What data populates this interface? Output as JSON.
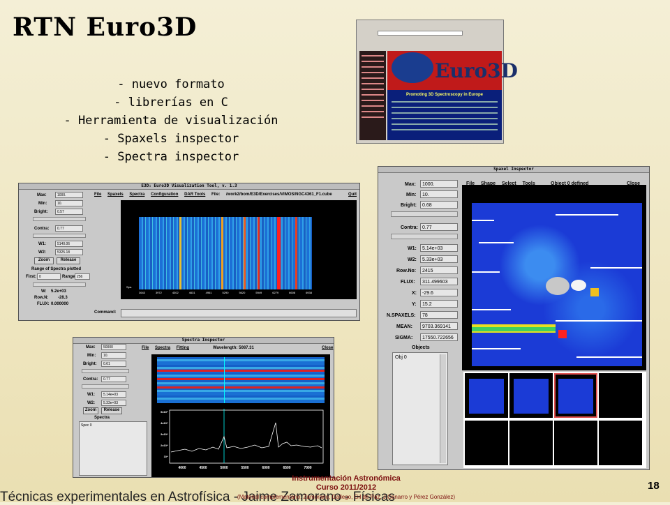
{
  "slide": {
    "title": "RTN Euro3D",
    "bullets": [
      "- nuevo formato",
      "- librerías en C",
      "- Herramienta de visualización",
      "- Spaxels inspector",
      "- Spectra inspector"
    ],
    "footer_left": "Técnicas experimentales en Astrofísica - Jaime Zamorano - Físicas",
    "footer_course": "Instrumentación Astronómica",
    "footer_year": "Curso 2011/2012",
    "footer_credit": "(Material complementario: Zamorano, Gallego, Gil de Paz, J.Cenarro y Pérez González)",
    "page_number": "18"
  },
  "website": {
    "logo_text": "Euro3D",
    "tagline": "Promoting 3D Spectroscopy in Europe"
  },
  "e3d_window": {
    "title": "E3D: Euro3D Visualization Tool, v. 1.3",
    "menu": [
      "File",
      "Spaxels",
      "Spectra",
      "Configuration",
      "DAR Tools",
      "File:"
    ],
    "file_path": "/work2/bom/E3D/Exercises/VIMOS/NGC4361_F1.cube",
    "quit": "Quit",
    "fields": [
      {
        "label": "Max:",
        "value": "1000."
      },
      {
        "label": "Min:",
        "value": "10."
      },
      {
        "label": "Bright:",
        "value": "0.57"
      },
      {
        "label": "Contra:",
        "value": "0.77"
      },
      {
        "label": "W1:",
        "value": "5140.06"
      },
      {
        "label": "W2:",
        "value": "5325.18"
      }
    ],
    "zoom": "Zoom",
    "release": "Release",
    "range_label": "Range of Spectra plotted",
    "first_label": "First:",
    "first_value": "0",
    "range_label2": "Range:",
    "range_value": "256",
    "w_label": "W:",
    "w_value": "5.2e+03",
    "rown_label": "Row.N:",
    "rown_value": "-28.3",
    "flux_label": "FLUX:",
    "flux_value": "0.000000",
    "command_label": "Command:",
    "x_ticks": [
      "3643",
      "3972",
      "4302",
      "4631",
      "4961",
      "5290",
      "5620",
      "5949",
      "6279",
      "6608",
      "6938"
    ],
    "spax_label": "Spa."
  },
  "spectra_window": {
    "title": "Spectra Inspector",
    "menu": [
      "File",
      "Spectra",
      "Fitting"
    ],
    "wavelength": "Wavelength: 5087.31",
    "close": "Close",
    "fields": [
      {
        "label": "Max:",
        "value": "50000"
      },
      {
        "label": "Min:",
        "value": "10."
      },
      {
        "label": "Bright:",
        "value": "0.61"
      },
      {
        "label": "Contra:",
        "value": "0.77"
      },
      {
        "label": "W1:",
        "value": "5.14e+03"
      },
      {
        "label": "W2:",
        "value": "5.33e+03"
      }
    ],
    "zoom": "Zoom",
    "release": "Release",
    "spectra_label": "Spectra",
    "spectra_item": "Spec 0",
    "y_ticks": [
      "5x10⁴",
      "4x10⁴",
      "3x10⁴",
      "2x10⁴",
      "10⁴"
    ],
    "x_ticks": [
      "4000",
      "4500",
      "5000",
      "5500",
      "6000",
      "6500",
      "7000"
    ]
  },
  "spaxel_window": {
    "title": "Spaxel Inspector",
    "menu": [
      "File",
      "Shape",
      "Select",
      "Tools"
    ],
    "status": "Object 0 defined",
    "close": "Close",
    "fields": [
      {
        "label": "Max:",
        "value": "1000."
      },
      {
        "label": "Min:",
        "value": "10."
      },
      {
        "label": "Bright:",
        "value": "0.68"
      },
      {
        "label": "Contra:",
        "value": "0.77"
      },
      {
        "label": "W1:",
        "value": "5.14e+03"
      },
      {
        "label": "W2:",
        "value": "5.33e+03"
      },
      {
        "label": "Row.No:",
        "value": "2415"
      },
      {
        "label": "FLUX:",
        "value": "311.499603"
      },
      {
        "label": "X:",
        "value": "-29.6"
      },
      {
        "label": "Y:",
        "value": "15.2"
      },
      {
        "label": "N.SPAXELS:",
        "value": "78"
      },
      {
        "label": "MEAN:",
        "value": "9703.369141"
      },
      {
        "label": "SIGMA:",
        "value": "17550.722656"
      }
    ],
    "objects_label": "Objects",
    "object_item": "Obj 0"
  },
  "colors": {
    "accent_red": "#7a0d0d",
    "spaxel_blue": "#1b3bd6"
  }
}
